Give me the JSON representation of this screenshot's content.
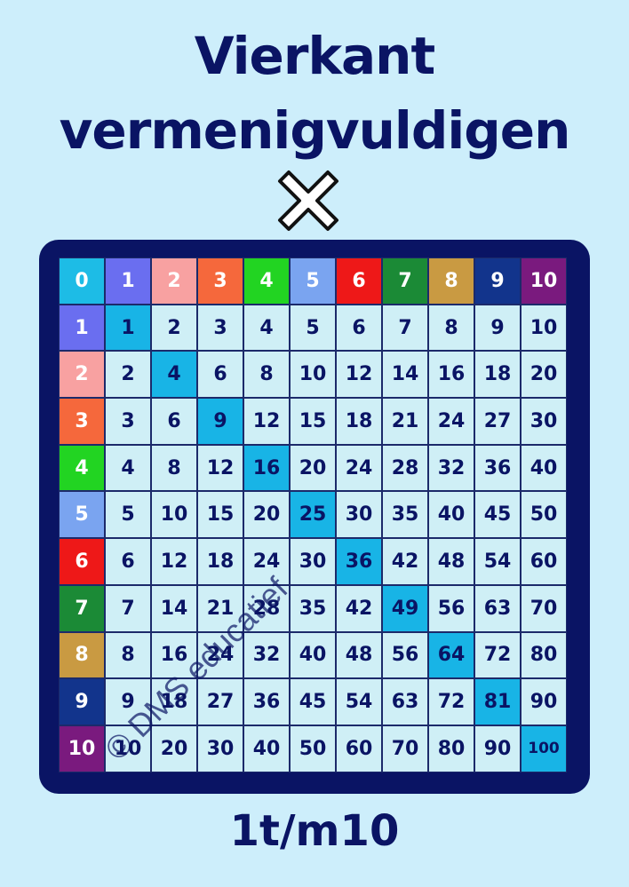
{
  "title_line1": "Vierkant",
  "title_line2": "vermenigvuldigen",
  "operator_icon": "multiply-x-icon",
  "footer": "1t/m10",
  "watermark": "© DMS educatief",
  "colors": {
    "background": "#cdeefb",
    "board": "#0a1464",
    "diagonal": "#18b4e6",
    "text": "#0a1464"
  },
  "table": {
    "header_colors": [
      "#1dbce6",
      "#6a6ef0",
      "#f8a1a1",
      "#f5683c",
      "#22d422",
      "#7aa4f0",
      "#ee1818",
      "#1b8a36",
      "#c99a42",
      "#12348c",
      "#7a1a7e"
    ],
    "rows": [
      [
        "0",
        "1",
        "2",
        "3",
        "4",
        "5",
        "6",
        "7",
        "8",
        "9",
        "10"
      ],
      [
        "1",
        "1",
        "2",
        "3",
        "4",
        "5",
        "6",
        "7",
        "8",
        "9",
        "10"
      ],
      [
        "2",
        "2",
        "4",
        "6",
        "8",
        "10",
        "12",
        "14",
        "16",
        "18",
        "20"
      ],
      [
        "3",
        "3",
        "6",
        "9",
        "12",
        "15",
        "18",
        "21",
        "24",
        "27",
        "30"
      ],
      [
        "4",
        "4",
        "8",
        "12",
        "16",
        "20",
        "24",
        "28",
        "32",
        "36",
        "40"
      ],
      [
        "5",
        "5",
        "10",
        "15",
        "20",
        "25",
        "30",
        "35",
        "40",
        "45",
        "50"
      ],
      [
        "6",
        "6",
        "12",
        "18",
        "24",
        "30",
        "36",
        "42",
        "48",
        "54",
        "60"
      ],
      [
        "7",
        "7",
        "14",
        "21",
        "28",
        "35",
        "42",
        "49",
        "56",
        "63",
        "70"
      ],
      [
        "8",
        "8",
        "16",
        "24",
        "32",
        "40",
        "48",
        "56",
        "64",
        "72",
        "80"
      ],
      [
        "9",
        "9",
        "18",
        "27",
        "36",
        "45",
        "54",
        "63",
        "72",
        "81",
        "90"
      ],
      [
        "10",
        "10",
        "20",
        "30",
        "40",
        "50",
        "60",
        "70",
        "80",
        "90",
        "100"
      ]
    ]
  }
}
